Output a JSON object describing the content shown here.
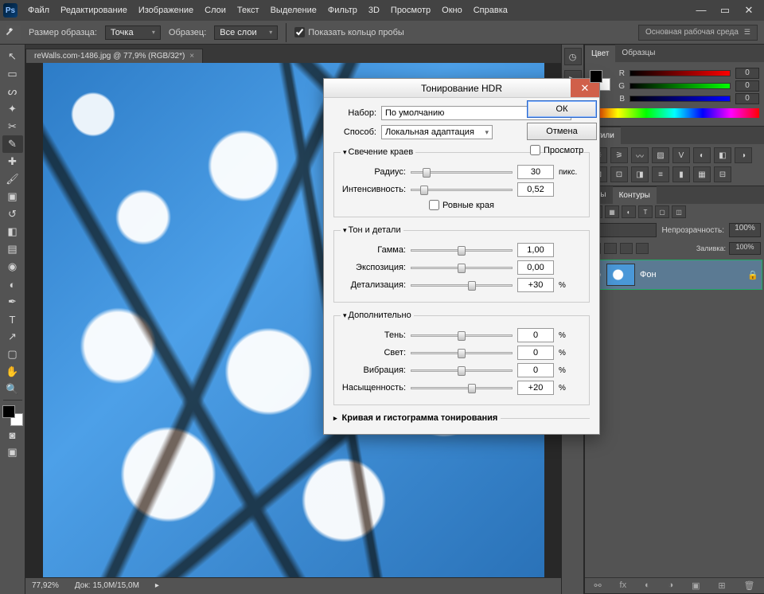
{
  "menubar": {
    "items": [
      "Файл",
      "Редактирование",
      "Изображение",
      "Слои",
      "Текст",
      "Выделение",
      "Фильтр",
      "3D",
      "Просмотр",
      "Окно",
      "Справка"
    ]
  },
  "options": {
    "sample_size_lbl": "Размер образца:",
    "sample_size_val": "Точка",
    "sample_lbl": "Образец:",
    "sample_val": "Все слои",
    "show_ring": "Показать кольцо пробы",
    "workspace": "Основная рабочая среда"
  },
  "doc": {
    "tab": "reWalls.com-1486.jpg @ 77,9% (RGB/32*)",
    "zoom": "77,92%",
    "doc_label": "Док:",
    "doc_size": "15,0M/15,0M"
  },
  "color_panel": {
    "tabs": [
      "Цвет",
      "Образцы"
    ],
    "channels": [
      {
        "l": "R",
        "v": "0"
      },
      {
        "l": "G",
        "v": "0"
      },
      {
        "l": "B",
        "v": "0"
      }
    ]
  },
  "styles_panel": {
    "tab": "Стили"
  },
  "layers_panel": {
    "tabs": [
      "алы",
      "Контуры"
    ],
    "opacity_lbl": "Непрозрачность:",
    "opacity_val": "100%",
    "fill_lbl": "Заливка:",
    "fill_val": "100%",
    "layer_name": "Фон"
  },
  "hdr": {
    "title": "Тонирование HDR",
    "preset_lbl": "Набор:",
    "preset_val": "По умолчанию",
    "method_lbl": "Способ:",
    "method_val": "Локальная адаптация",
    "ok": "ОК",
    "cancel": "Отмена",
    "preview": "Просмотр",
    "edge_group": "Свечение краев",
    "radius_lbl": "Радиус:",
    "radius_val": "30",
    "radius_unit": "пикс.",
    "strength_lbl": "Интенсивность:",
    "strength_val": "0,52",
    "smooth_edges": "Ровные края",
    "tone_group": "Тон и детали",
    "gamma_lbl": "Гамма:",
    "gamma_val": "1,00",
    "exposure_lbl": "Экспозиция:",
    "exposure_val": "0,00",
    "detail_lbl": "Детализация:",
    "detail_val": "+30",
    "pct": "%",
    "adv_group": "Дополнительно",
    "shadow_lbl": "Тень:",
    "shadow_val": "0",
    "highlight_lbl": "Свет:",
    "highlight_val": "0",
    "vibrance_lbl": "Вибрация:",
    "vibrance_val": "0",
    "saturation_lbl": "Насыщенность:",
    "saturation_val": "+20",
    "curve_lbl": "Кривая и гистограмма тонирования"
  }
}
